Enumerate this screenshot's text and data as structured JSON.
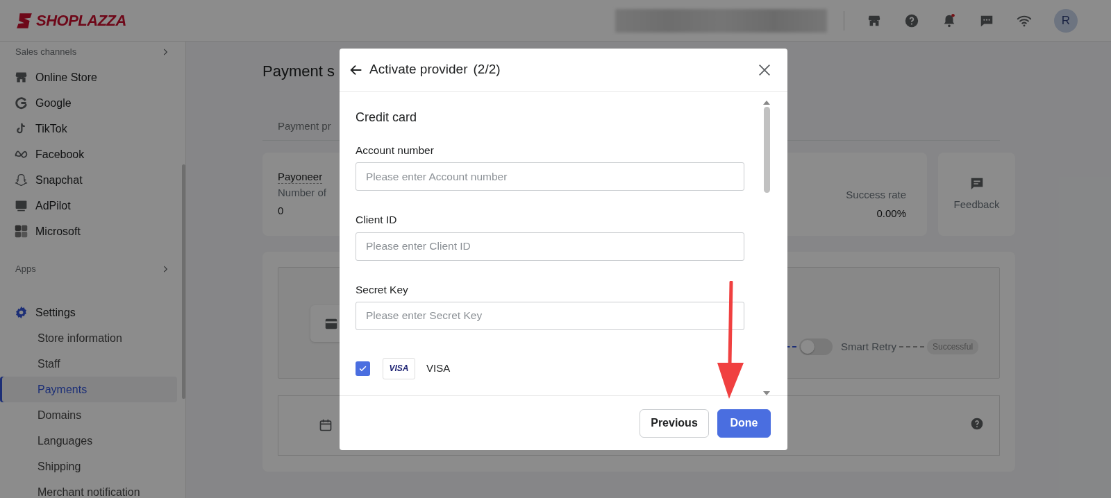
{
  "header": {
    "logo": "SHOPLAZZA",
    "avatar": "R"
  },
  "sidebar": {
    "groups": [
      {
        "title": "Sales channels",
        "items": [
          {
            "label": "Online Store"
          },
          {
            "label": "Google"
          },
          {
            "label": "TikTok"
          },
          {
            "label": "Facebook"
          },
          {
            "label": "Snapchat"
          },
          {
            "label": "AdPilot"
          },
          {
            "label": "Microsoft"
          }
        ]
      },
      {
        "title": "Apps"
      }
    ],
    "settings": {
      "label": "Settings",
      "items": [
        {
          "label": "Store information",
          "selected": false
        },
        {
          "label": "Staff",
          "selected": false
        },
        {
          "label": "Payments",
          "selected": true
        },
        {
          "label": "Domains",
          "selected": false
        },
        {
          "label": "Languages",
          "selected": false
        },
        {
          "label": "Shipping",
          "selected": false
        },
        {
          "label": "Merchant notification",
          "selected": false
        }
      ]
    }
  },
  "page": {
    "title": "Payment s",
    "tab": "Payment pr",
    "provider_card": {
      "name": "Payoneer",
      "metric_label": "Number of",
      "metric_value": "0",
      "rate_label": "Success rate",
      "rate_value": "0.00%"
    },
    "feedback": "Feedback",
    "flow": {
      "toggle_on": false,
      "step": "Smart Retry",
      "result": "Successful"
    }
  },
  "modal": {
    "title": "Activate provider",
    "step": "(2/2)",
    "section": "Credit card",
    "fields": [
      {
        "label": "Account number",
        "placeholder": "Please enter Account number"
      },
      {
        "label": "Client ID",
        "placeholder": "Please enter Client ID"
      },
      {
        "label": "Secret Key",
        "placeholder": "Please enter Secret Key"
      }
    ],
    "cards": [
      {
        "logo": "VISA",
        "label": "VISA",
        "checked": true
      }
    ],
    "buttons": [
      {
        "label": "Previous",
        "kind": "secondary"
      },
      {
        "label": "Done",
        "kind": "primary"
      }
    ]
  }
}
